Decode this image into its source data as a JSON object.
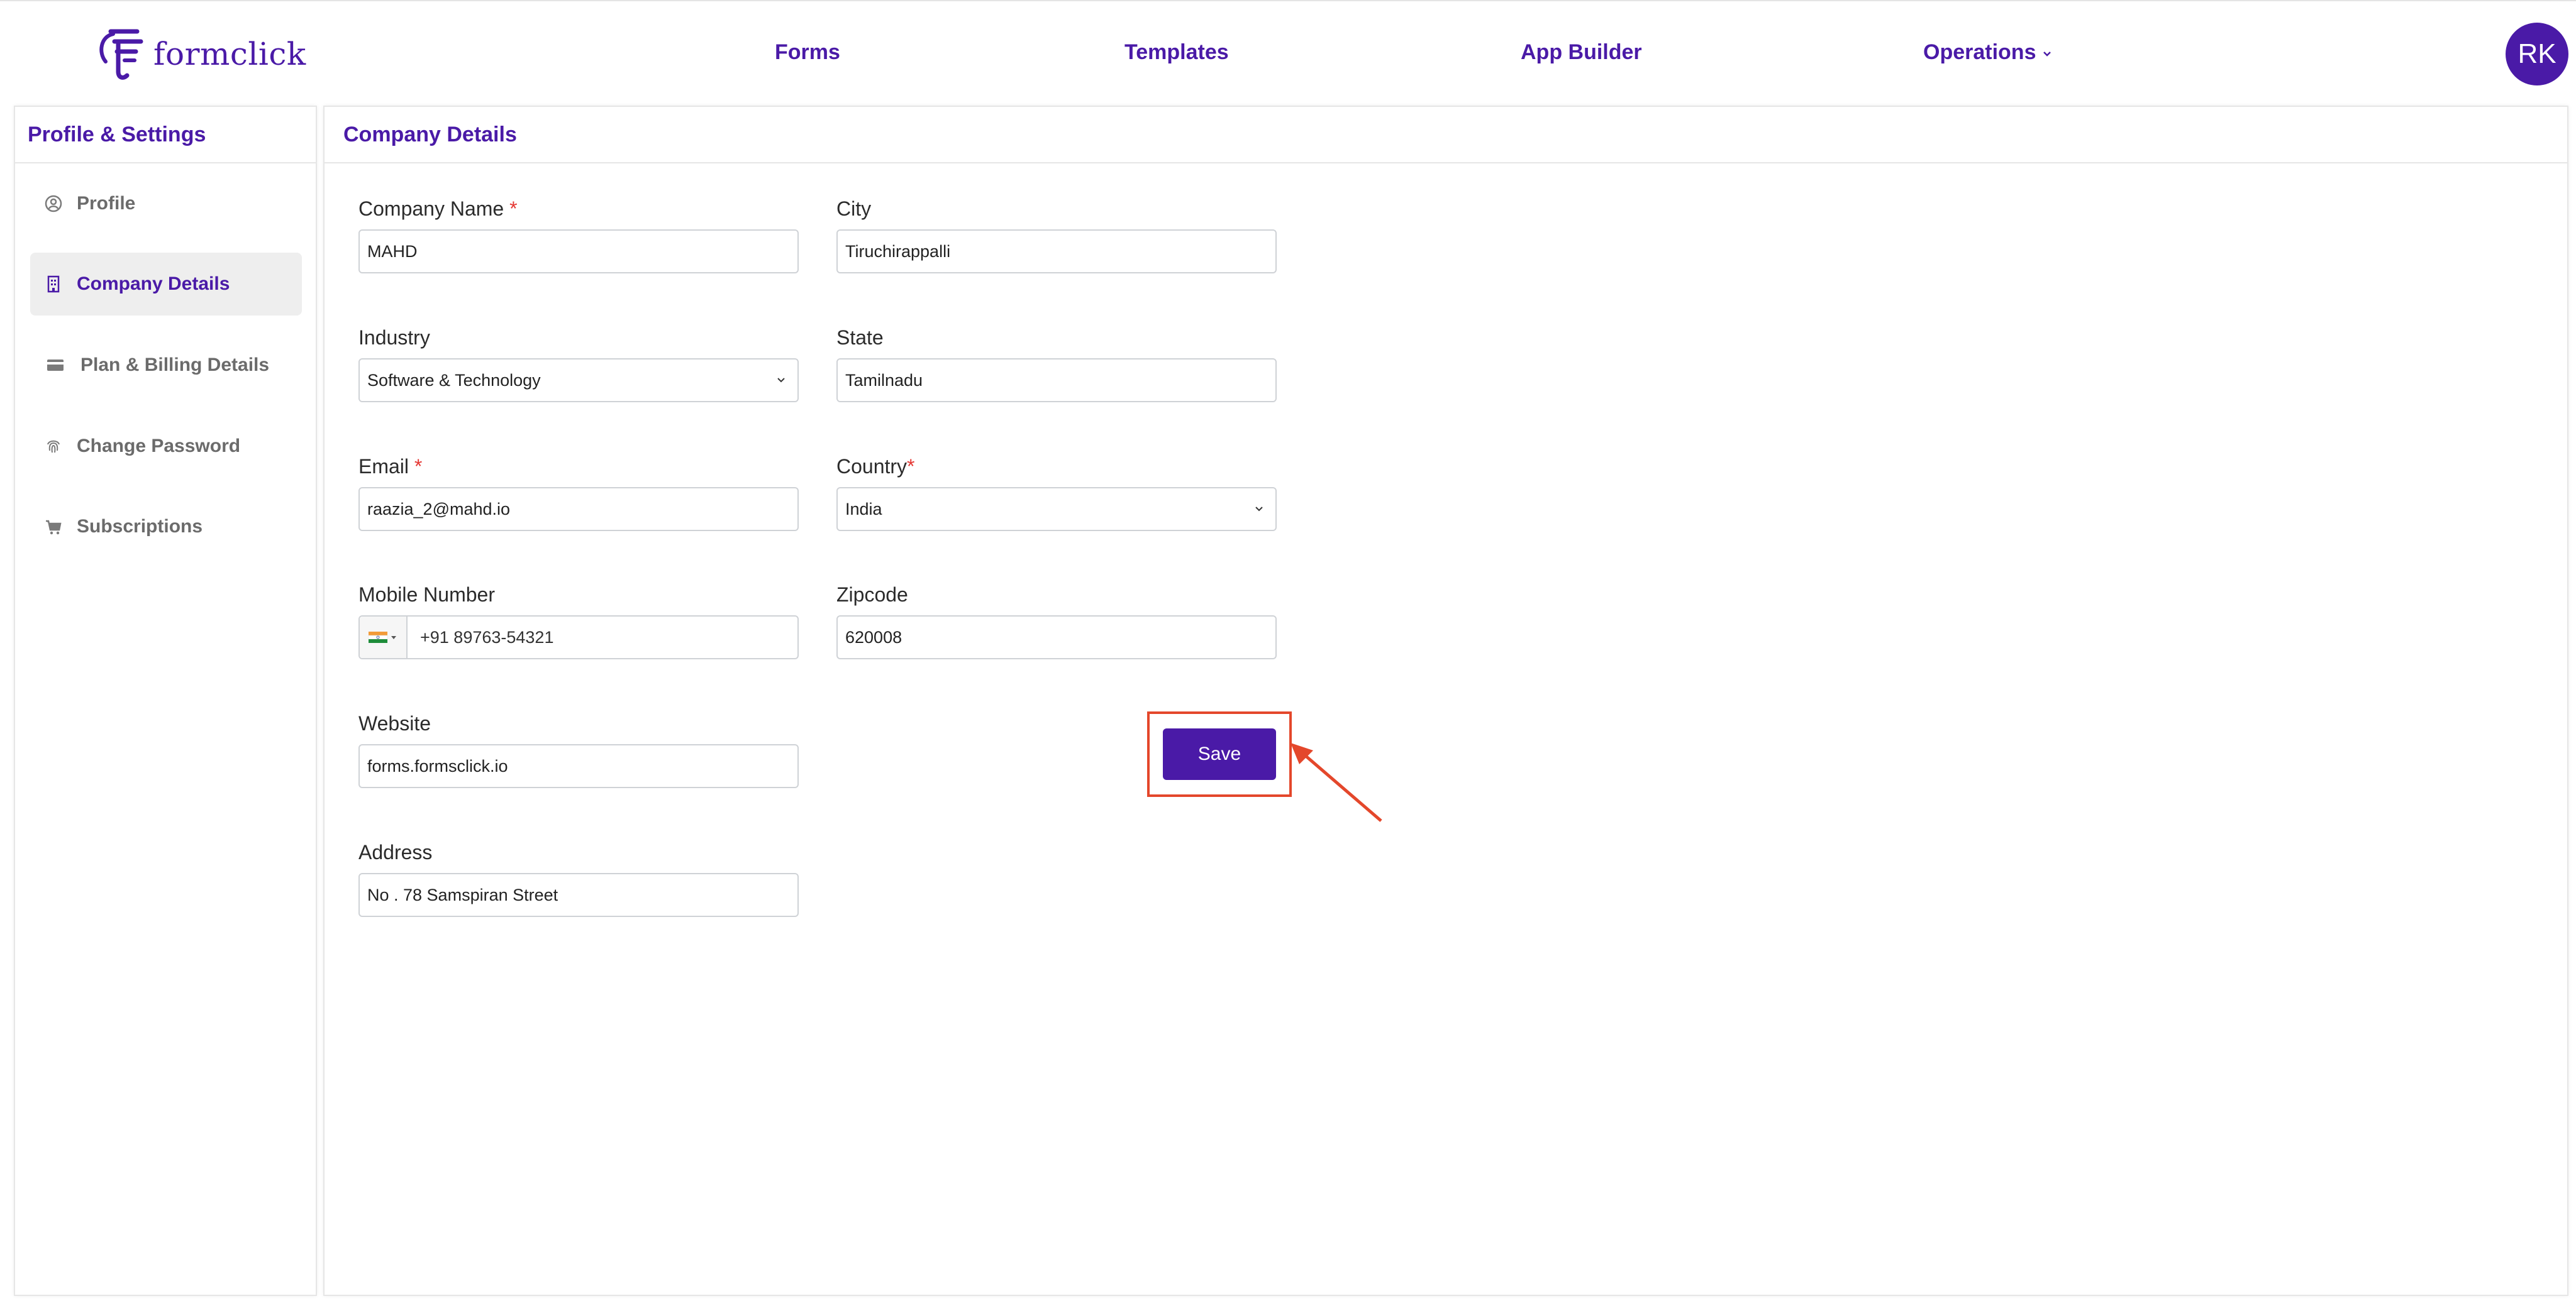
{
  "brand": {
    "name": "formclick"
  },
  "nav": {
    "forms": "Forms",
    "templates": "Templates",
    "app_builder": "App Builder",
    "operations": "Operations"
  },
  "user": {
    "initials": "RK"
  },
  "sidebar": {
    "title": "Profile & Settings",
    "items": [
      {
        "label": "Profile",
        "icon": "user-circle-icon"
      },
      {
        "label": "Company Details",
        "icon": "building-icon",
        "active": true
      },
      {
        "label": "Plan & Billing Details",
        "icon": "credit-card-icon"
      },
      {
        "label": "Change Password",
        "icon": "fingerprint-icon"
      },
      {
        "label": "Subscriptions",
        "icon": "cart-icon"
      }
    ]
  },
  "main": {
    "title": "Company Details",
    "fields": {
      "company_name": {
        "label": "Company Name",
        "required": "*",
        "value": "MAHD"
      },
      "industry": {
        "label": "Industry",
        "value": "Software & Technology"
      },
      "email": {
        "label": "Email",
        "required": "*",
        "value": "raazia_2@mahd.io"
      },
      "mobile": {
        "label": "Mobile Number",
        "value": "+91 89763-54321",
        "country_flag": "india-flag-icon"
      },
      "website": {
        "label": "Website",
        "value": "forms.formsclick.io"
      },
      "address": {
        "label": "Address",
        "value": "No . 78 Samspiran Street"
      },
      "city": {
        "label": "City",
        "value": "Tiruchirappalli"
      },
      "state": {
        "label": "State",
        "value": "Tamilnadu"
      },
      "country": {
        "label": "Country",
        "required": "*",
        "value": "India"
      },
      "zipcode": {
        "label": "Zipcode",
        "value": "620008"
      }
    },
    "save_label": "Save"
  },
  "colors": {
    "accent": "#4a1aa7",
    "highlight": "#e4472b",
    "required": "#e53935"
  }
}
